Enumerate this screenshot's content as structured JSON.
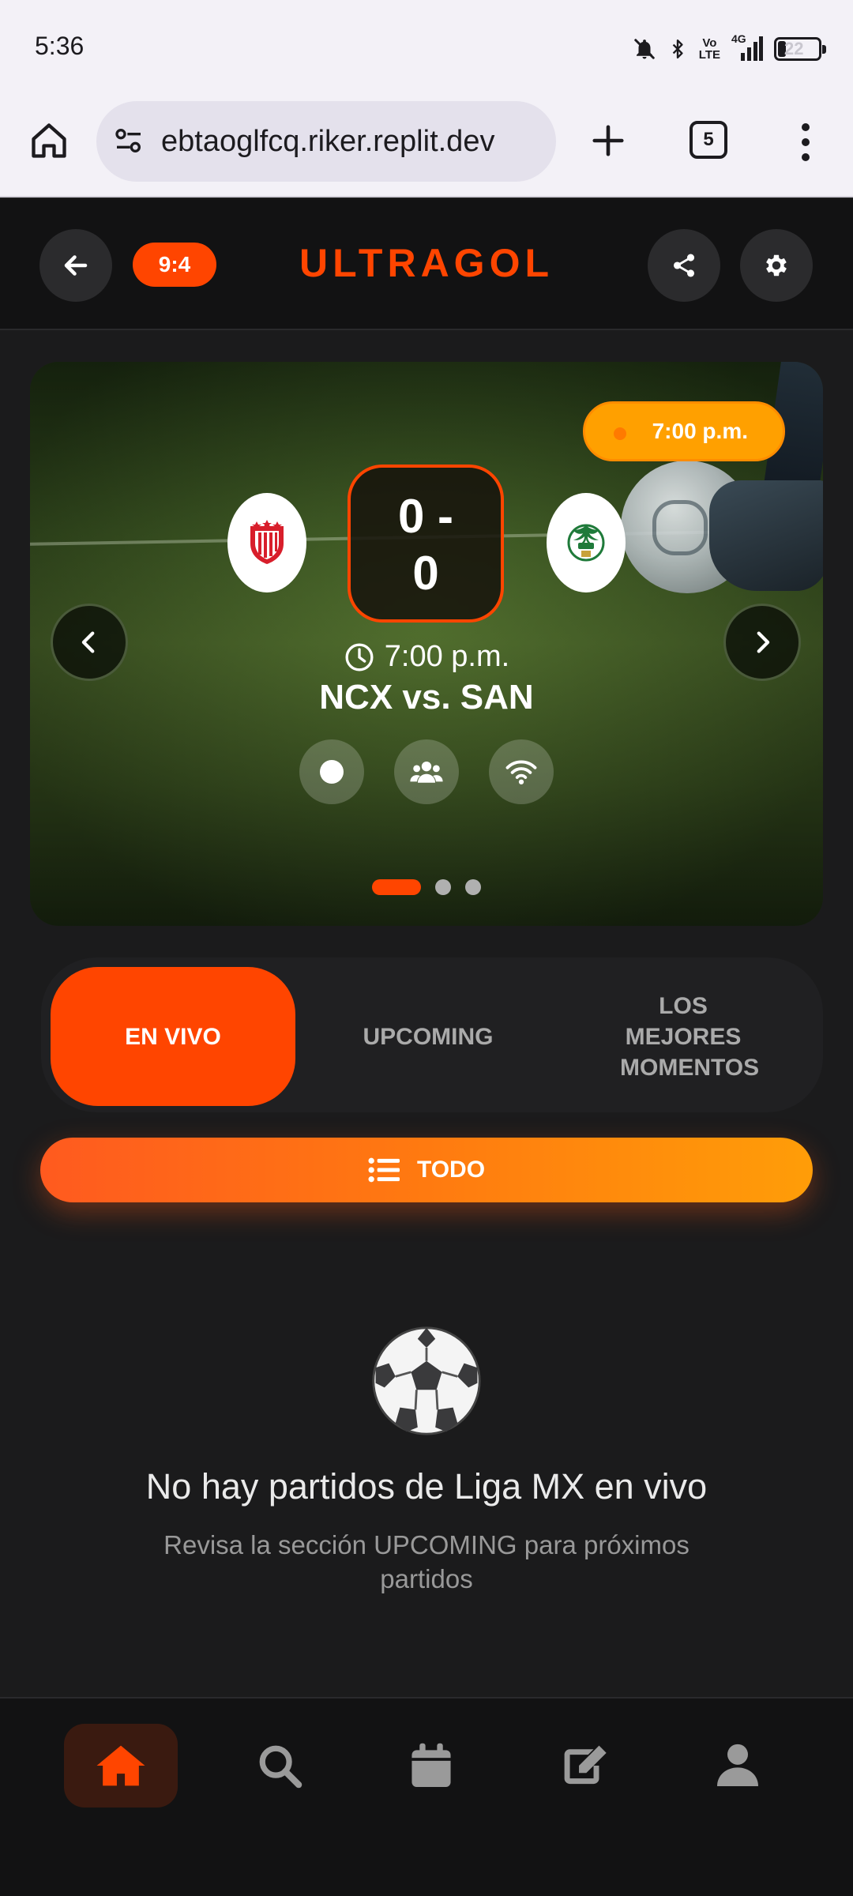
{
  "status_bar": {
    "time": "5:36",
    "volte": [
      "Vo",
      "LTE"
    ],
    "network": "4G",
    "battery": "22"
  },
  "browser": {
    "url": "ebtaoglfcq.riker.replit.dev",
    "tab_count": "5"
  },
  "header": {
    "ratio_badge": "9:4",
    "brand": "ULTRAGOL"
  },
  "hero": {
    "time_pill": "7:00 p.m.",
    "score": "0 - 0",
    "match_time": "7:00 p.m.",
    "match_name": "NCX vs. SAN",
    "slide_count": 3,
    "active_slide": 1
  },
  "tabs": [
    {
      "label": "EN VIVO",
      "active": true
    },
    {
      "label": "UPCOMING",
      "active": false
    },
    {
      "label": "LOS MEJORES MOMENTOS",
      "active": false
    }
  ],
  "filter": {
    "label": "TODO"
  },
  "empty_state": {
    "icon": "⚽",
    "title": "No hay partidos de Liga MX en vivo",
    "subtitle": "Revisa la sección UPCOMING para próximos partidos"
  },
  "colors": {
    "accent": "#ff4500",
    "pill": "#ffa000",
    "background": "#1b1b1c"
  },
  "bottom_nav": [
    "home-icon",
    "search-icon",
    "calendar-icon",
    "edit-icon",
    "user-icon"
  ]
}
